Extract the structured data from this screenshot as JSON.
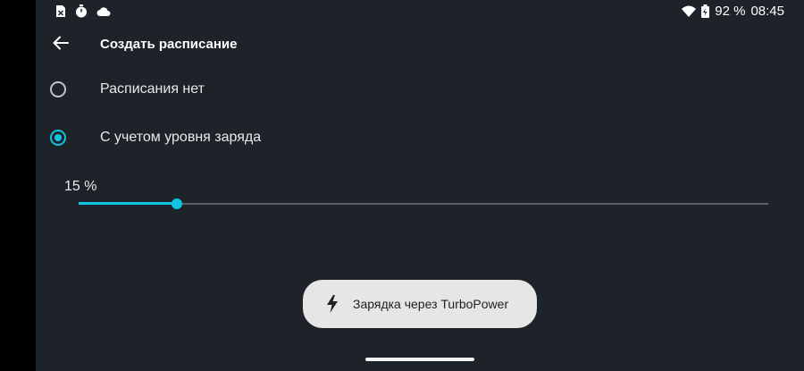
{
  "status_bar": {
    "left_icons": [
      "sim-card-icon",
      "timer-icon",
      "cloud-icon"
    ],
    "right_icons": [
      "wifi-icon",
      "battery-icon"
    ],
    "battery_text": "92 %",
    "time": "08:45"
  },
  "toolbar": {
    "title": "Создать расписание",
    "back_icon": "arrow-back-icon"
  },
  "options": [
    {
      "label": "Расписания нет",
      "selected": false
    },
    {
      "label": "С учетом уровня заряда",
      "selected": true
    }
  ],
  "slider": {
    "value_text": "15 %",
    "value_percent": 15,
    "level_fraction": 0.143
  },
  "toast": {
    "icon": "lightning-bolt-icon",
    "text": "Зарядка через TurboPower"
  },
  "colors": {
    "accent": "#10c4e0",
    "background": "#1d2329",
    "toast_background": "#e6e6e6"
  }
}
